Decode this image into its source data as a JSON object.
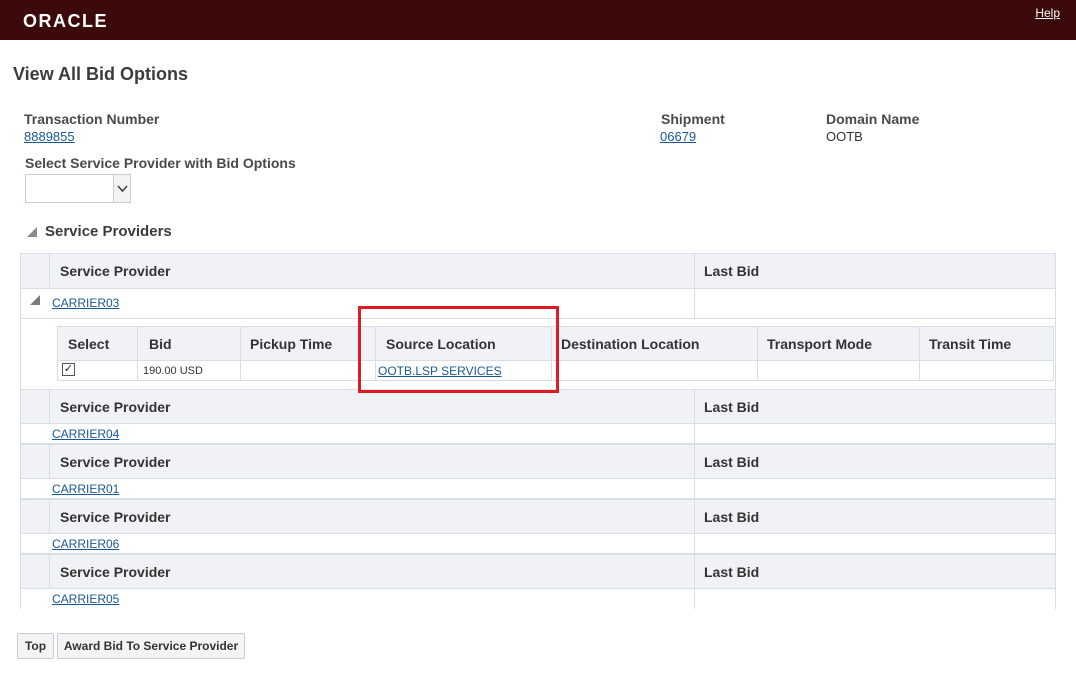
{
  "header": {
    "logo": "ORACLE",
    "help": "Help"
  },
  "page": {
    "title": "View All Bid Options"
  },
  "fields": {
    "transaction_number_label": "Transaction Number",
    "transaction_number": "8889855",
    "shipment_label": "Shipment",
    "shipment": "06679",
    "domain_label": "Domain Name",
    "domain": "OOTB",
    "provider_select_label": "Select Service Provider with Bid Options",
    "provider_select_value": ""
  },
  "section": {
    "title": "Service Providers"
  },
  "providers_table": {
    "col_provider": "Service Provider",
    "col_last_bid": "Last Bid",
    "providers": [
      {
        "name": "CARRIER03",
        "last_bid": ""
      },
      {
        "name": "CARRIER04",
        "last_bid": ""
      },
      {
        "name": "CARRIER01",
        "last_bid": ""
      },
      {
        "name": "CARRIER06",
        "last_bid": ""
      },
      {
        "name": "CARRIER05",
        "last_bid": ""
      }
    ]
  },
  "bids_table": {
    "columns": [
      "Select",
      "Bid",
      "Pickup Time",
      "Source Location",
      "Destination Location",
      "Transport Mode",
      "Transit Time"
    ],
    "rows": [
      {
        "selected": true,
        "check_glyph": "✓",
        "bid": "190.00 USD",
        "pickup_time": "",
        "source_location": "OOTB.LSP SERVICES",
        "destination_location": "",
        "transport_mode": "",
        "transit_time": ""
      }
    ]
  },
  "buttons": {
    "top": "Top",
    "award": "Award Bid To Service Provider"
  },
  "colors": {
    "topbar": "#3c0a0a",
    "link": "#1a5894",
    "highlight": "#e01b24"
  }
}
